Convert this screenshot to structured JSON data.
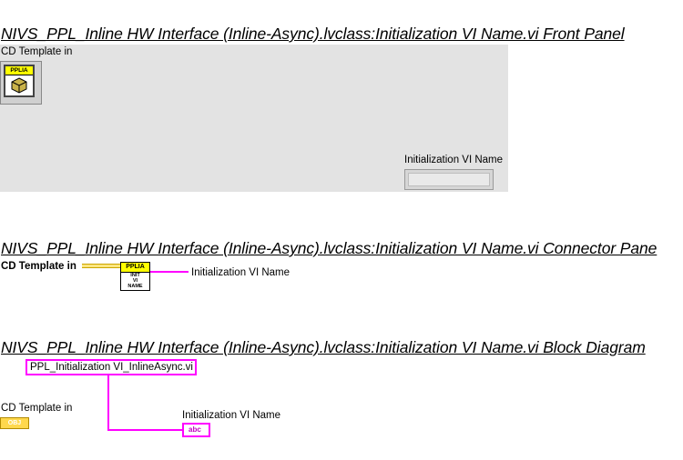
{
  "front_panel": {
    "heading": "NIVS_PPL_Inline HW Interface (Inline-Async).lvclass:Initialization VI Name.vi Front Panel",
    "control_label": "CD Template in",
    "control_icon_text": "PPLIA",
    "indicator_label": "Initialization VI Name"
  },
  "connector_pane": {
    "heading": "NIVS_PPL_Inline HW Interface (Inline-Async).lvclass:Initialization VI Name.vi Connector Pane",
    "input_label": "CD Template in",
    "output_label": "Initialization VI Name",
    "icon_header": "PPLIA",
    "icon_lines": [
      "INIT",
      "VI",
      "NAME"
    ]
  },
  "block_diagram": {
    "heading": "NIVS_PPL_Inline HW Interface (Inline-Async).lvclass:Initialization VI Name.vi Block Diagram",
    "string_constant": "PPL_Initialization VI_InlineAsync.vi",
    "input_label": "CD Template in",
    "input_terminal": "OBJ",
    "output_label": "Initialization VI Name",
    "output_terminal": "abc"
  }
}
